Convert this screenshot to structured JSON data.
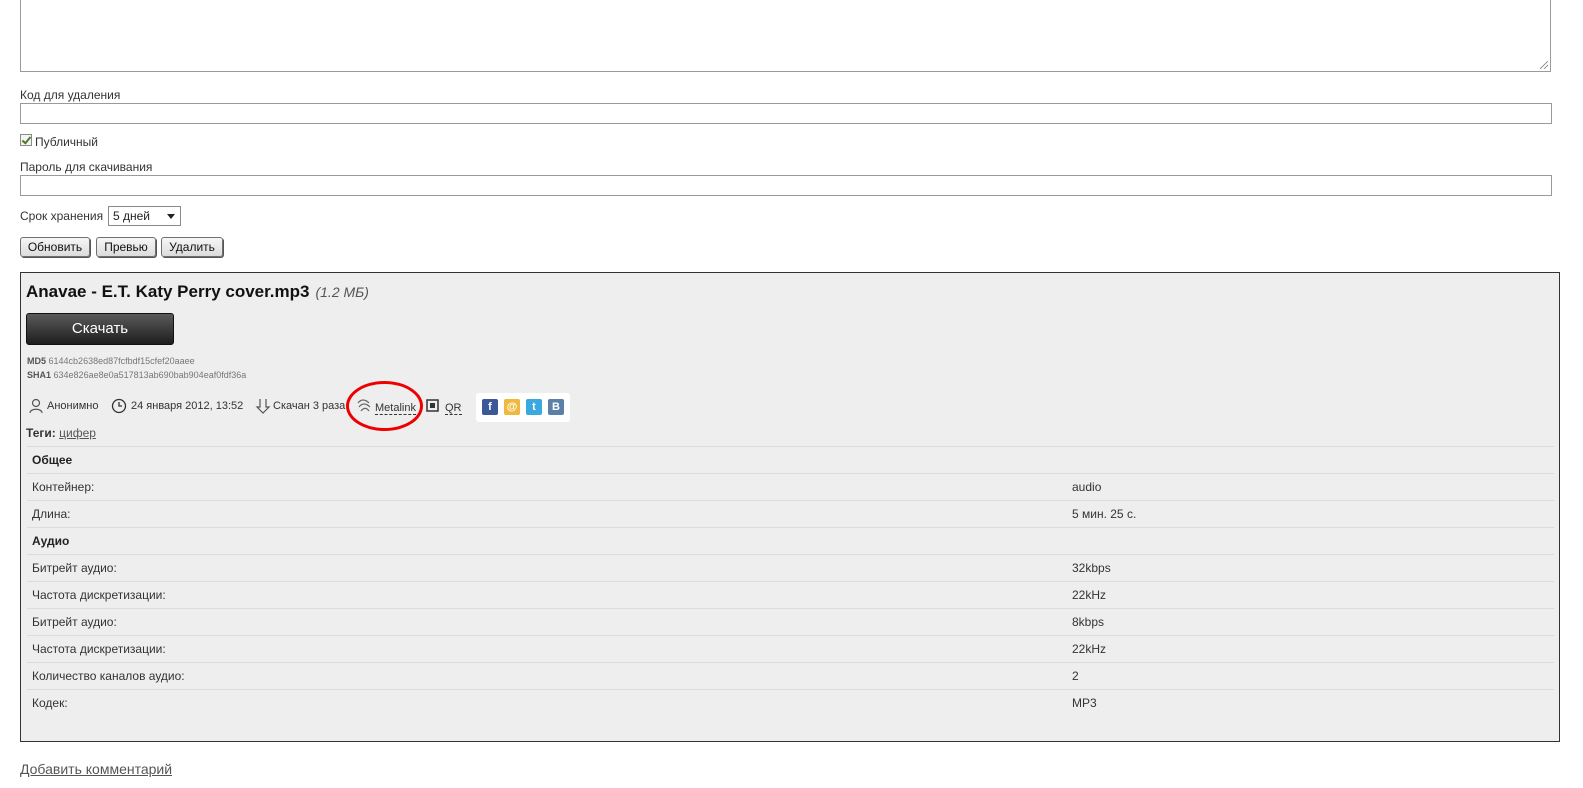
{
  "form": {
    "delete_code_label": "Код для удаления",
    "public_label": "Публичный",
    "public_checked": true,
    "download_password_label": "Пароль для скачивания",
    "storage_period_label": "Срок хранения",
    "storage_period_value": "5 дней",
    "buttons": {
      "update": "Обновить",
      "preview": "Превью",
      "delete": "Удалить"
    }
  },
  "file": {
    "name": "Anavae - E.T. Katy Perry cover.mp3",
    "size": "(1.2 МБ)",
    "download_label": "Скачать",
    "md5_label": "MD5",
    "md5": "6144cb2638ed87fcfbdf15cfef20aaee",
    "sha1_label": "SHA1",
    "sha1": "634e826ae8e0a517813ab690bab904eaf0fdf36a",
    "author": "Анонимно",
    "date": "24 января 2012, 13:52",
    "downloads": "Скачан 3 раза",
    "metalink_label": "Metalink",
    "qr_label": "QR",
    "tags_label": "Теги:",
    "tag": "цифер"
  },
  "icons": {
    "social": [
      "facebook-icon",
      "mail-icon",
      "twitter-icon",
      "vkontakte-icon"
    ]
  },
  "info_table": {
    "rows": [
      {
        "type": "section",
        "label": "Общее"
      },
      {
        "type": "row",
        "label": "Контейнер:",
        "value": "audio"
      },
      {
        "type": "row",
        "label": "Длина:",
        "value": "5 мин. 25 с."
      },
      {
        "type": "section",
        "label": "Аудио"
      },
      {
        "type": "row",
        "label": "Битрейт аудио:",
        "value": "32kbps"
      },
      {
        "type": "row",
        "label": "Частота дискретизации:",
        "value": "22kHz"
      },
      {
        "type": "row",
        "label": "Битрейт аудио:",
        "value": "8kbps"
      },
      {
        "type": "row",
        "label": "Частота дискретизации:",
        "value": "22kHz"
      },
      {
        "type": "row",
        "label": "Количество каналов аудио:",
        "value": "2"
      },
      {
        "type": "row",
        "label": "Кодек:",
        "value": "MP3"
      }
    ]
  },
  "footer": {
    "add_comment": "Добавить комментарий"
  },
  "colors": {
    "panel_bg": "#eeeeee",
    "highlight_ring": "#e00000",
    "download_button": "#2a2a2a"
  }
}
